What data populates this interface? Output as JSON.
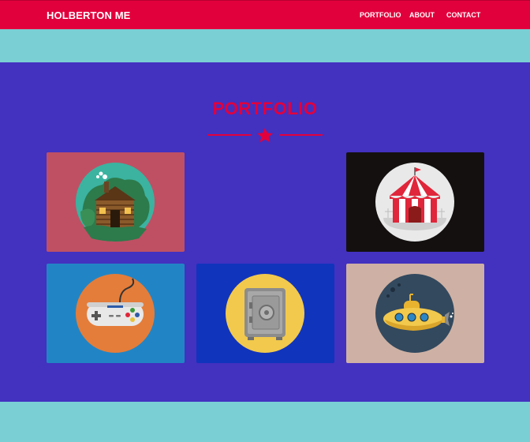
{
  "nav": {
    "brand": "HOLBERTON ME",
    "links": [
      "PORTFOLIO",
      "ABOUT",
      "CONTACT"
    ]
  },
  "portfolio": {
    "title": "PORTFOLIO",
    "items": [
      {
        "icon": "cabin-icon",
        "bg": "#BF5064"
      },
      {
        "icon": "circus-tent-icon",
        "bg": "#141010"
      },
      {
        "icon": "game-controller-icon",
        "bg": "#2185C5"
      },
      {
        "icon": "safe-icon",
        "bg": "#1134BC"
      },
      {
        "icon": "submarine-icon",
        "bg": "#CEB1A4"
      }
    ]
  },
  "colors": {
    "nav_bg": "#E2003C",
    "section_bg": "#4331C0",
    "page_bg": "#7ACFD4",
    "accent": "#E2003C"
  }
}
